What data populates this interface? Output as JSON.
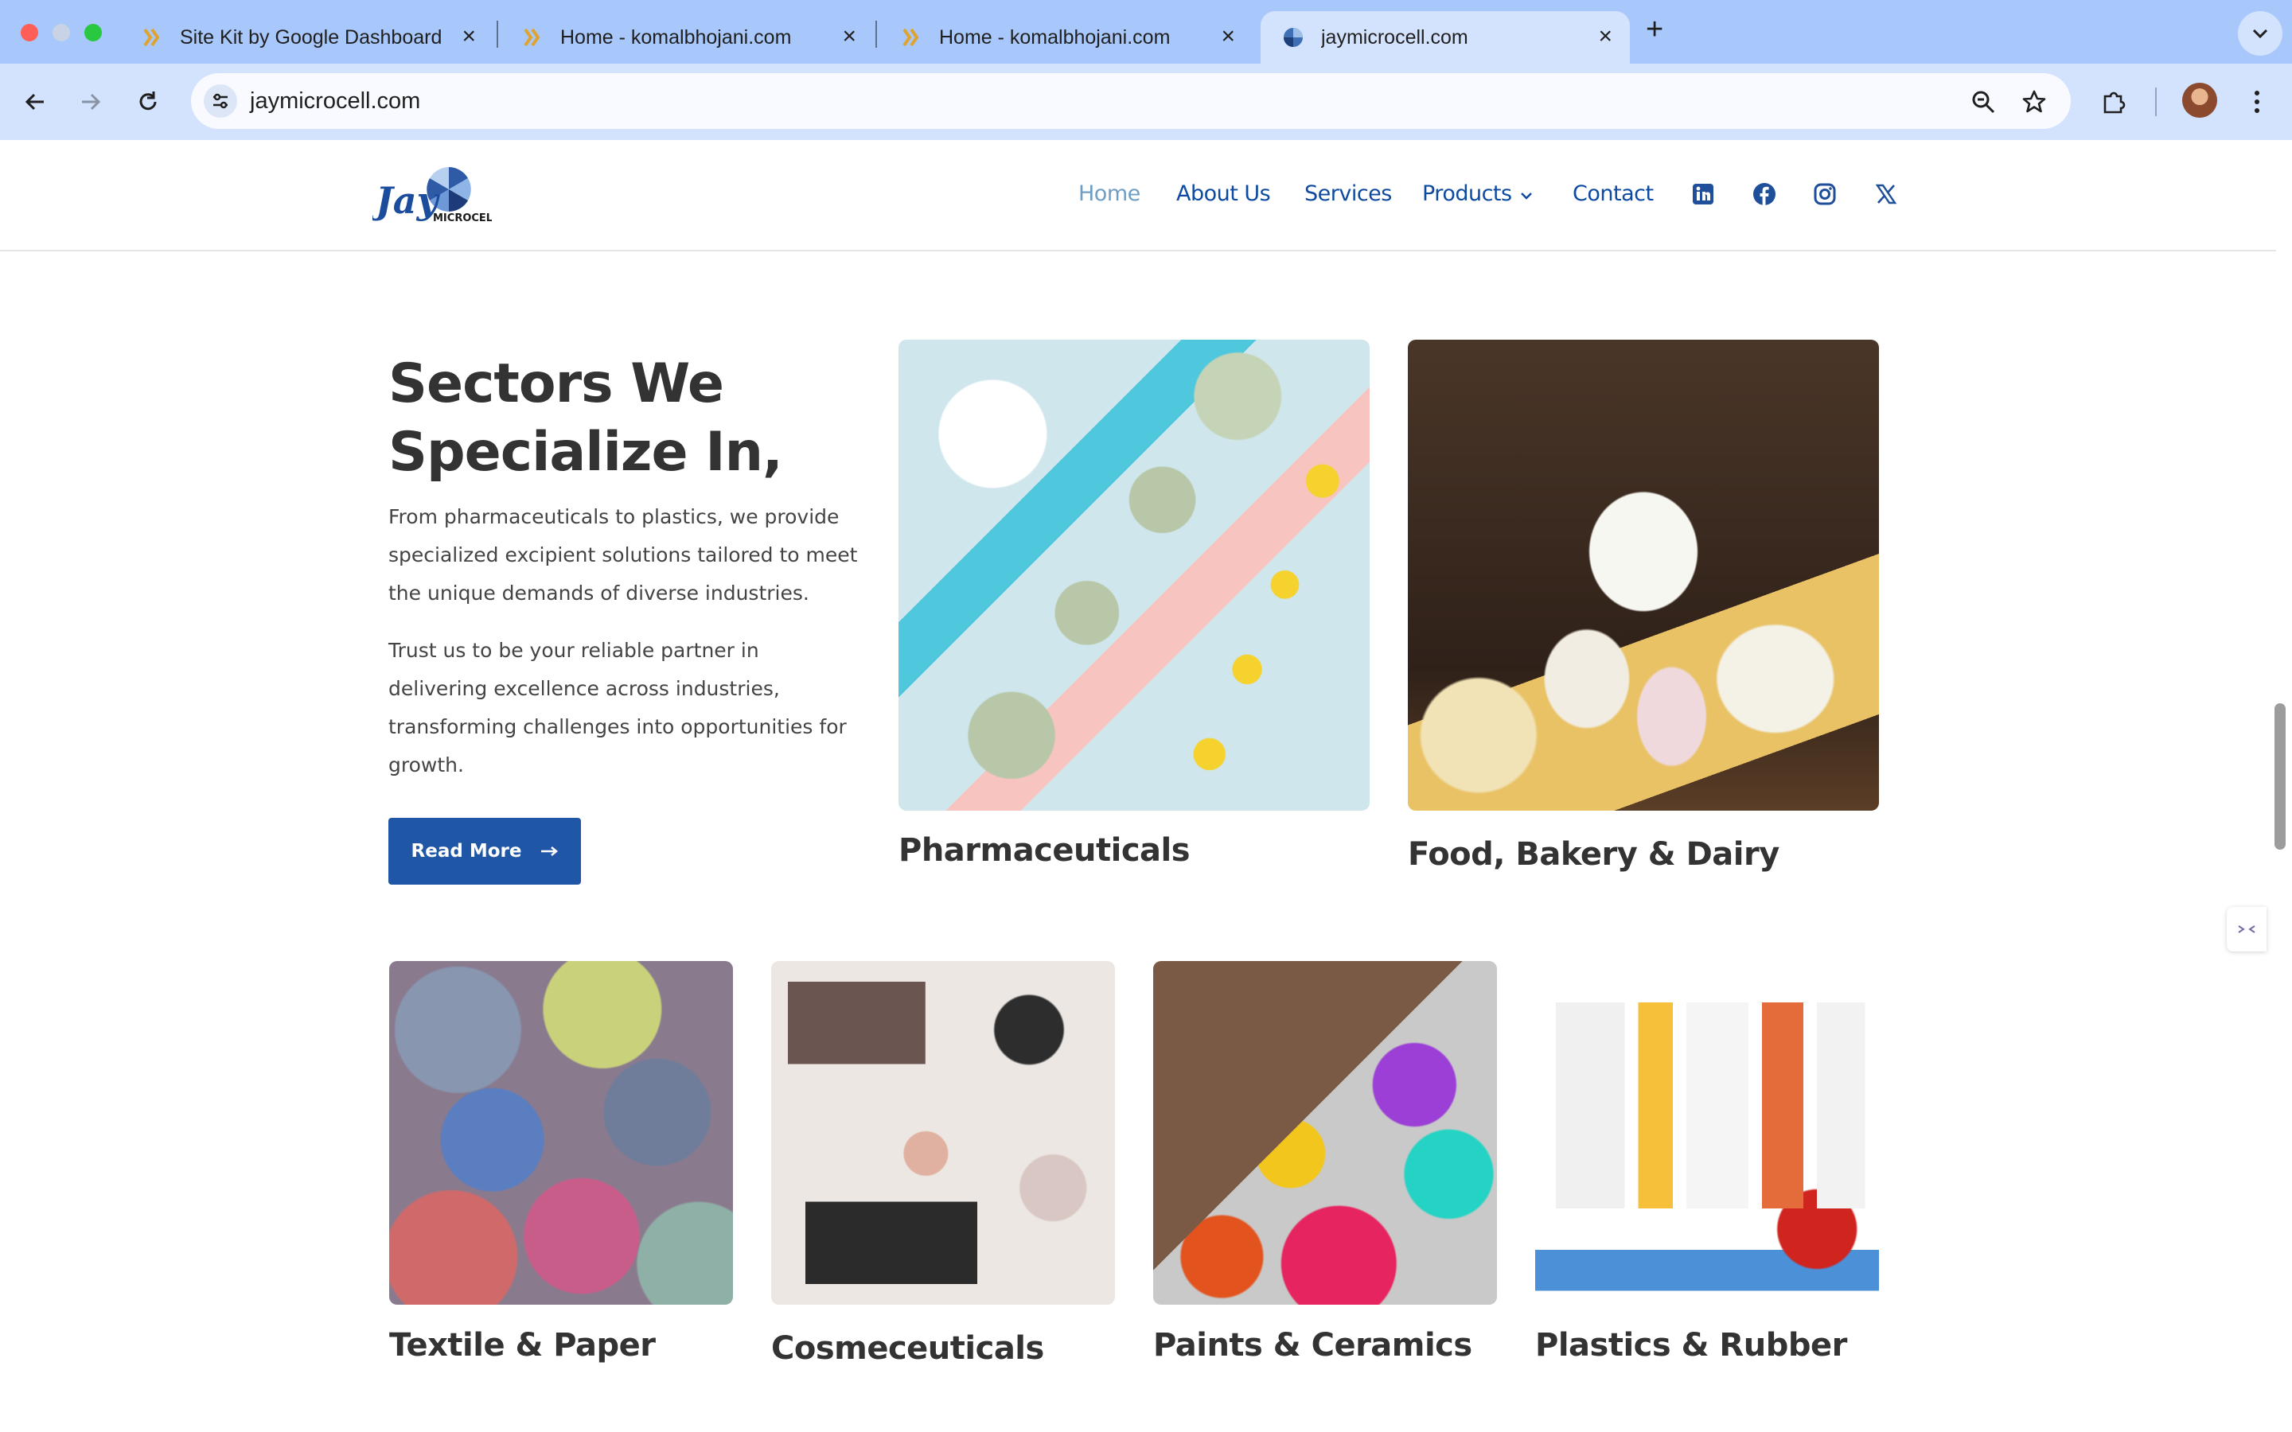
{
  "browser": {
    "tabs": [
      {
        "title": "Site Kit by Google Dashboard"
      },
      {
        "title": "Home - komalbhojani.com"
      },
      {
        "title": "Home - komalbhojani.com"
      },
      {
        "title": "jaymicrocell.com"
      }
    ],
    "url": "jaymicrocell.com",
    "colors": {
      "tabstrip": "#a8c7fa",
      "toolbar": "#d3e3fd"
    }
  },
  "site": {
    "logo_text": "JAY MICROCELL",
    "nav": {
      "home": "Home",
      "about": "About Us",
      "services": "Services",
      "products": "Products",
      "contact": "Contact"
    },
    "social_icons": [
      "linkedin-icon",
      "facebook-icon",
      "instagram-icon",
      "x-twitter-icon"
    ],
    "colors": {
      "nav": "#0d4aa0",
      "nav_active": "#6f9ec4",
      "button": "#1f56a5",
      "heading": "#333333"
    }
  },
  "sectors": {
    "heading": "Sectors We Specialize In,",
    "paragraph_1": "From pharmaceuticals to plastics, we provide specialized excipient solutions tailored to meet the unique demands of diverse industries.",
    "paragraph_2": "Trust us to be your reliable partner in delivering excellence across industries, transforming challenges into opportunities for growth.",
    "read_more": "Read More",
    "cards": [
      {
        "label": "Pharmaceuticals"
      },
      {
        "label": "Food, Bakery & Dairy"
      },
      {
        "label": "Textile & Paper"
      },
      {
        "label": "Cosmeceuticals"
      },
      {
        "label": "Paints & Ceramics"
      },
      {
        "label": "Plastics & Rubber"
      }
    ]
  }
}
